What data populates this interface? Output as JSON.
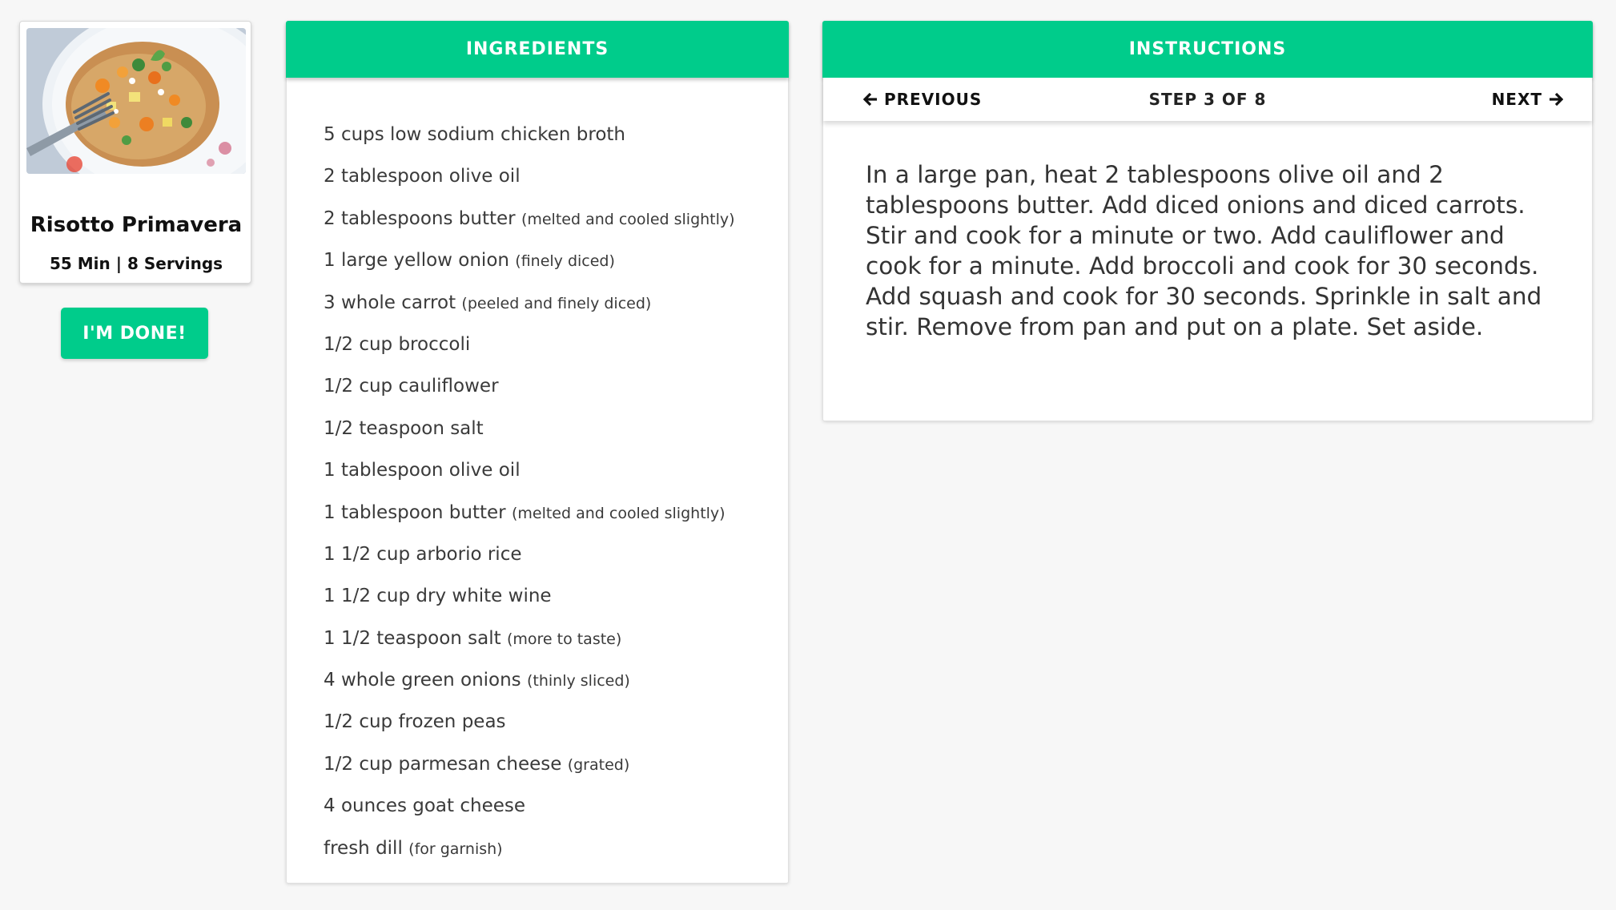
{
  "recipe": {
    "title": "Risotto Primavera",
    "meta": "55 Min | 8 Servings",
    "photo_icon": "risotto-dish-photo"
  },
  "actions": {
    "done_label": "I'M DONE!"
  },
  "ingredients": {
    "header": "INGREDIENTS",
    "items": [
      {
        "text": "5 cups low sodium chicken broth",
        "note": ""
      },
      {
        "text": "2 tablespoon olive oil",
        "note": ""
      },
      {
        "text": "2 tablespoons butter",
        "note": "(melted and cooled slightly)"
      },
      {
        "text": "1 large yellow onion",
        "note": "(finely diced)"
      },
      {
        "text": "3 whole carrot",
        "note": "(peeled and finely diced)"
      },
      {
        "text": "1/2 cup broccoli",
        "note": ""
      },
      {
        "text": "1/2 cup cauliflower",
        "note": ""
      },
      {
        "text": "1/2 teaspoon salt",
        "note": ""
      },
      {
        "text": "1 tablespoon olive oil",
        "note": ""
      },
      {
        "text": "1 tablespoon butter",
        "note": "(melted and cooled slightly)"
      },
      {
        "text": "1 1/2 cup arborio rice",
        "note": ""
      },
      {
        "text": "1 1/2 cup dry white wine",
        "note": ""
      },
      {
        "text": "1 1/2 teaspoon salt",
        "note": "(more to taste)"
      },
      {
        "text": "4 whole green onions",
        "note": "(thinly sliced)"
      },
      {
        "text": "1/2 cup frozen peas",
        "note": ""
      },
      {
        "text": "1/2 cup parmesan cheese",
        "note": "(grated)"
      },
      {
        "text": "4 ounces goat cheese",
        "note": ""
      },
      {
        "text": "fresh dill",
        "note": "(for garnish)"
      }
    ]
  },
  "instructions": {
    "header": "INSTRUCTIONS",
    "previous_label": "PREVIOUS",
    "next_label": "NEXT",
    "step_counter": "STEP 3 OF 8",
    "current_step": 3,
    "total_steps": 8,
    "step_text": "In a large pan, heat 2 tablespoons olive oil and 2 tablespoons butter. Add diced onions and diced carrots. Stir and cook for a minute or two. Add cauliflower and cook for a minute. Add broccoli and cook for 30 seconds. Add squash and cook for 30 seconds. Sprinkle in salt and stir. Remove from pan and put on a plate. Set aside."
  },
  "colors": {
    "accent": "#00cc8b",
    "background": "#f7f7f7",
    "text": "#333333"
  }
}
